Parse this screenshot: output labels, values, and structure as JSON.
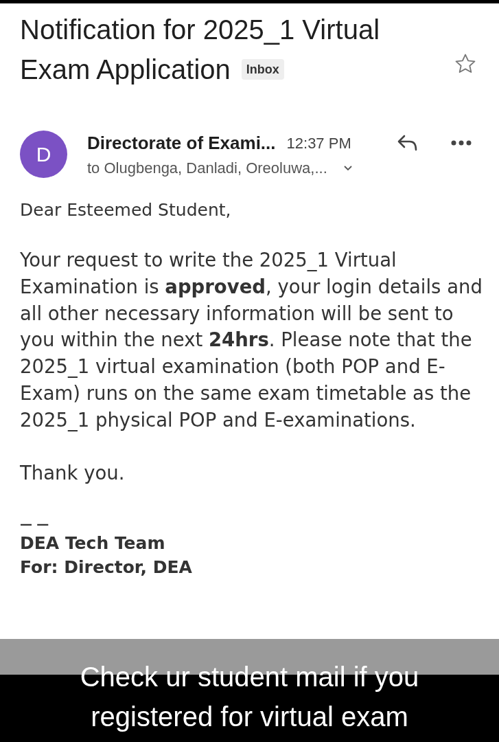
{
  "email": {
    "subject": [
      "Notification for 2025_1 Virtual",
      "Exam Application"
    ],
    "label": "Inbox",
    "starred": false,
    "sender": {
      "initial": "D",
      "name": "Directorate of Exami...",
      "time": "12:37 PM",
      "recipients": "to Olugbenga, Danladi, Oreoluwa,..."
    },
    "body": {
      "greeting": "Dear Esteemed Student,",
      "paragraphs": [
        "Your request to write the 2025_1 Virtual Examination is **approved**, your login details and all other necessary information will be sent to you within the next **24hrs**. Please note that the 2025_1 virtual examination (both POP and E-Exam) runs on the same exam timetable as the 2025_1 physical POP and E-examinations.",
        "Thank you."
      ],
      "separator": "— —",
      "signature": [
        "DEA Tech Team",
        "For: Director, DEA"
      ]
    }
  },
  "caption": "Check ur student mail if you\nregistered for virtual exam"
}
